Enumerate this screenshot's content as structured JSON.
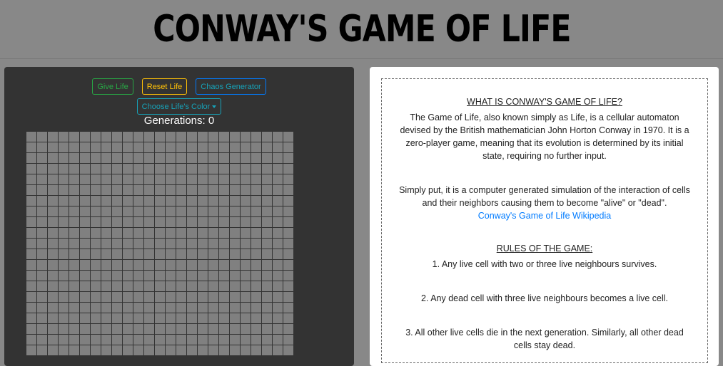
{
  "header": {
    "title": "CONWAY'S GAME OF LIFE"
  },
  "controls": {
    "give_life": "Give Life",
    "reset_life": "Reset Life",
    "chaos_generator": "Chaos Generator",
    "choose_color": "Choose Life's Color"
  },
  "generations_text": "Generations: 0",
  "grid": {
    "cols": 25,
    "rows": 21,
    "cell_color": "#808080"
  },
  "info": {
    "heading_what": "WHAT IS CONWAY'S GAME OF LIFE?",
    "paragraph_1": "The Game of Life, also known simply as Life, is a cellular automaton devised by the British mathematician John Horton Conway in 1970. It is a zero-player game, meaning that its evolution is determined by its initial state, requiring no further input.",
    "paragraph_2": "Simply put, it is a computer generated simulation of the interaction of cells and their neighbors causing them to become \"alive\" or \"dead\".",
    "wiki_link": "Conway's Game of Life Wikipedia",
    "heading_rules": "RULES OF THE GAME:",
    "rule_1": "1. Any live cell with two or three live neighbours survives.",
    "rule_2": "2. Any dead cell with three live neighbours becomes a live cell.",
    "rule_3": "3. All other live cells die in the next generation. Similarly, all other dead cells stay dead."
  },
  "colors": {
    "give_life": "#28a745",
    "reset_life": "#ffc107",
    "chaos_generator": "#17a2b8",
    "link": "#007bff"
  }
}
